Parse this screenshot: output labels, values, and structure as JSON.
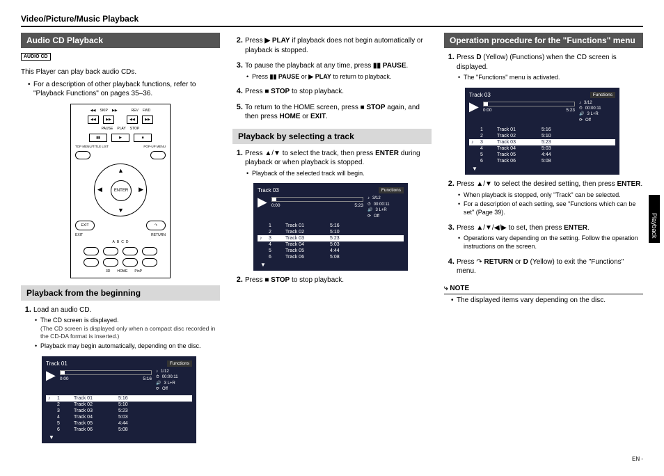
{
  "header": "Video/Picture/Music Playback",
  "side_tab": "Playback",
  "col1": {
    "heading": "Audio CD Playback",
    "badge": "AUDIO CD",
    "intro": "This Player can play back audio CDs.",
    "intro_bullet": "For a description of other playback functions, refer to \"Playback Functions\" on pages 35–36.",
    "remote": {
      "row1": [
        "◀◀",
        "SKIP",
        "▶▶",
        "REV",
        "FWD"
      ],
      "row2": {
        "pause": "PAUSE",
        "play": "PLAY",
        "stop": "STOP"
      },
      "row3": [
        "TOP MENU/TITLE LIST",
        "POP-UP MENU"
      ],
      "enter": "ENTER",
      "row_exit": {
        "exit": "EXIT",
        "return": "RETURN"
      },
      "row_abcd": [
        "A",
        "B",
        "C",
        "D"
      ],
      "row_bottom": [
        "",
        "3D",
        "HOME",
        "PinP"
      ]
    },
    "subheading": "Playback from the beginning",
    "step1": {
      "text": "Load an audio CD.",
      "b1": "The CD screen is displayed.",
      "b1_paren": "(The CD screen is displayed only when a compact disc recorded in the CD-DA format is inserted.)",
      "b2": "Playback may begin automatically, depending on the disc."
    },
    "playbox1": {
      "title": "Track 01",
      "func": "Functions",
      "time_l": "0:00",
      "time_r": "5:16",
      "info": [
        [
          "♪",
          "1/12"
        ],
        [
          "⏱",
          "00:00:11"
        ],
        [
          "🔊",
          "3   L+R"
        ],
        [
          "⟳",
          "Off"
        ]
      ],
      "rows": [
        {
          "sel": true,
          "n": "1",
          "t": "Track 01",
          "d": "5:16"
        },
        {
          "sel": false,
          "n": "2",
          "t": "Track 02",
          "d": "5:10"
        },
        {
          "sel": false,
          "n": "3",
          "t": "Track 03",
          "d": "5:23"
        },
        {
          "sel": false,
          "n": "4",
          "t": "Track 04",
          "d": "5:03"
        },
        {
          "sel": false,
          "n": "5",
          "t": "Track 05",
          "d": "4:44"
        },
        {
          "sel": false,
          "n": "6",
          "t": "Track 06",
          "d": "5:08"
        }
      ]
    }
  },
  "col2": {
    "s2": "Press ▶ PLAY if playback does not begin automatically or playback is stopped.",
    "s3": "To pause the playback at any time, press ▮▮ PAUSE.",
    "s3b": "Press ▮▮ PAUSE or ▶ PLAY to return to playback.",
    "s4": "Press ■ STOP to stop playback.",
    "s5": "To return to the HOME screen, press ■ STOP again, and then press HOME or EXIT.",
    "subheading": "Playback by selecting a track",
    "t1": "Press ▲/▼ to select the track, then press ENTER during playback or when playback is stopped.",
    "t1b": "Playback of the selected track will begin.",
    "playbox2": {
      "title": "Track 03",
      "func": "Functions",
      "time_l": "0:00",
      "time_r": "5:23",
      "info": [
        [
          "♪",
          "3/12"
        ],
        [
          "⏱",
          "00:00:11"
        ],
        [
          "🔊",
          "3   L+R"
        ],
        [
          "⟳",
          "Off"
        ]
      ],
      "rows": [
        {
          "sel": false,
          "n": "1",
          "t": "Track 01",
          "d": "5:16"
        },
        {
          "sel": false,
          "n": "2",
          "t": "Track 02",
          "d": "5:10"
        },
        {
          "sel": true,
          "n": "3",
          "t": "Track 03",
          "d": "5:23"
        },
        {
          "sel": false,
          "n": "4",
          "t": "Track 04",
          "d": "5:03"
        },
        {
          "sel": false,
          "n": "5",
          "t": "Track 05",
          "d": "4:44"
        },
        {
          "sel": false,
          "n": "6",
          "t": "Track 06",
          "d": "5:08"
        }
      ]
    },
    "t2": "Press ■ STOP to stop playback."
  },
  "col3": {
    "heading": "Operation procedure for the \"Functions\" menu",
    "s1": "Press D (Yellow) (Functions) when the CD screen is displayed.",
    "s1b": "The \"Functions\" menu is activated.",
    "playbox3": {
      "title": "Track 03",
      "func": "Functions",
      "time_l": "0:00",
      "time_r": "5:23",
      "info": [
        [
          "♪",
          "3/12"
        ],
        [
          "⏱",
          "00:00:11"
        ],
        [
          "🔊",
          "3   L+R"
        ],
        [
          "⟳",
          "Off"
        ]
      ],
      "rows": [
        {
          "sel": false,
          "n": "1",
          "t": "Track 01",
          "d": "5:16"
        },
        {
          "sel": false,
          "n": "2",
          "t": "Track 02",
          "d": "5:10"
        },
        {
          "sel": true,
          "n": "3",
          "t": "Track 03",
          "d": "5:23"
        },
        {
          "sel": false,
          "n": "4",
          "t": "Track 04",
          "d": "5:03"
        },
        {
          "sel": false,
          "n": "5",
          "t": "Track 05",
          "d": "4:44"
        },
        {
          "sel": false,
          "n": "6",
          "t": "Track 06",
          "d": "5:08"
        }
      ]
    },
    "s2": "Press ▲/▼ to select the desired setting, then press ENTER.",
    "s2b1": "When playback is stopped, only \"Track\" can be selected.",
    "s2b2": "For a description of each setting, see \"Functions which can be set\" (Page 39).",
    "s3": "Press ▲/▼/◀/▶ to set, then press ENTER.",
    "s3b": "Operations vary depending on the setting. Follow the operation instructions on the screen.",
    "s4": "Press ↷ RETURN or D (Yellow) to exit the \"Functions\" menu.",
    "note_label": "⤷ NOTE",
    "note": "The displayed items vary depending on the disc."
  },
  "page_num": "EN -"
}
